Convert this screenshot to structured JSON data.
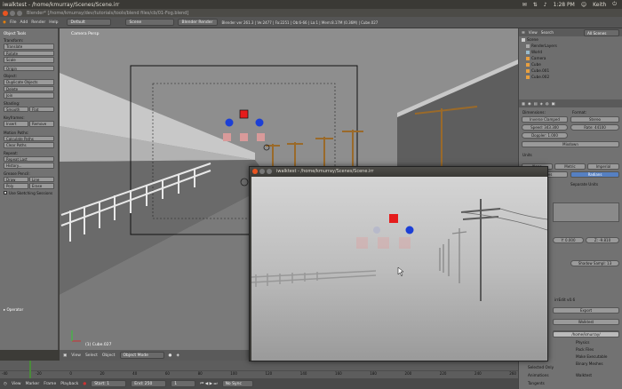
{
  "topbar": {
    "window_title": "iwalktest - /home/kmurray/Scenes/Scene.irr",
    "time": "1:28 PM",
    "user": "Keith"
  },
  "blender_title": "Blender* [/home/kmurray/dev/tutorials/tools/blend files/cb/01-Fog.blend]",
  "menubar": {
    "items": [
      "File",
      "Add",
      "Render",
      "Help"
    ],
    "layout": "Default",
    "scene": "Scene",
    "engine": "Blender Render",
    "stats": "Blender ver 261.3 | Ve:2477 | Fa:2251 | Ob:6-66 | La:1 | Mem:8.17M (0.36M) | Cube.027"
  },
  "tools": {
    "header": "Object Tools",
    "sections": [
      {
        "title": "Transform:",
        "buttons": [
          "Translate",
          "Rotate",
          "Scale"
        ]
      },
      {
        "title": "",
        "buttons": [
          "Origin"
        ]
      },
      {
        "title": "Object:",
        "buttons": [
          "Duplicate Objects",
          "Delete",
          "Join"
        ]
      },
      {
        "title": "Shading:",
        "pair": [
          "Smooth",
          "Flat"
        ]
      },
      {
        "title": "Keyframes:",
        "pair": [
          "Insert",
          "Remove"
        ]
      },
      {
        "title": "Motion Paths:",
        "buttons": [
          "Calculate Paths",
          "Clear Paths"
        ]
      },
      {
        "title": "Repeat:",
        "buttons": [
          "Repeat Last",
          "History..."
        ]
      },
      {
        "title": "Grease Pencil:",
        "pair": [
          "Draw",
          "Line"
        ],
        "pair2": [
          "Poly",
          "Erase"
        ]
      }
    ],
    "sketch": "Use Sketching Sessions",
    "operator": "Operator"
  },
  "viewport": {
    "label": "Camera Persp",
    "object_label": "(1) Cube.027"
  },
  "bottombar": {
    "items": [
      "View",
      "Select",
      "Object"
    ],
    "mode": "Object Mode",
    "pivot": "Global"
  },
  "timeline": {
    "ticks": [
      "-40",
      "-20",
      "0",
      "20",
      "40",
      "60",
      "80",
      "100",
      "120",
      "140",
      "160",
      "180",
      "200",
      "220",
      "240",
      "260"
    ],
    "menu": [
      "View",
      "Marker",
      "Frame",
      "Playback"
    ],
    "start": "Start: 1",
    "end": "End: 250",
    "current": "1",
    "sync": "No Sync"
  },
  "outliner": {
    "view": "View",
    "search": "Search",
    "scenes": "All Scenes",
    "items": [
      "Scene",
      "RenderLayers",
      "World",
      "Camera",
      "Cube",
      "Cube.001",
      "Cube.002"
    ]
  },
  "props": {
    "dimensions_label": "Dimensions:",
    "format_label": "Format:",
    "format_value": "Inverse Clamped",
    "stereo": "Stereo",
    "speed": "Speed: 343.300",
    "rate": "Rate: 44100",
    "doppler": "Doppler: 1.000",
    "mixdown": "Mixdown",
    "units": "Units",
    "none": "None",
    "metric": "Metric",
    "imperial": "Imperial",
    "degrees": "Degrees",
    "radians": "Radians",
    "separate_units": "Separate Units",
    "y": "Y: 0.000",
    "z": "Z: -9.810",
    "shadow_sample": "Shadow Sampl: 13",
    "export": "Export",
    "walkteat": "Walktest",
    "path": "/home/kmurray/Scenes/",
    "path2": "/home/kmurray/",
    "physics": "Physics",
    "pack_files": "Pack Files",
    "make_executable": "Make Executable",
    "binary_meshes": "Binary Meshes",
    "selected_only": "Selected Only",
    "animations": "Animations",
    "walktest_cb": "Walktest",
    "tangents": "Tangents",
    "irrEdit": "irrEdit v0.6"
  },
  "irr": {
    "title": "iwalktest - /home/kmurray/Scenes/Scene.irr"
  },
  "colors": {
    "red": "#e51c1c",
    "blue": "#1c3fd6",
    "ubuntu_orange": "#e95420"
  }
}
